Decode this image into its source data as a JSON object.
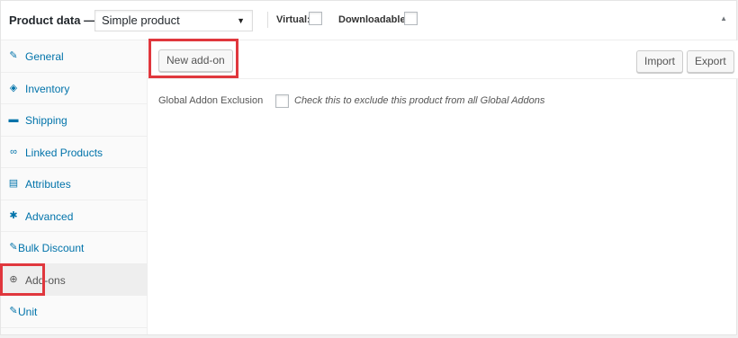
{
  "header": {
    "title": "Product data —",
    "product_type": "Simple product",
    "virtual_label": "Virtual:",
    "downloadable_label": "Downloadable:"
  },
  "sidebar": {
    "items": [
      {
        "label": "General",
        "icon": "wrench-icon",
        "glyph": "✎"
      },
      {
        "label": "Inventory",
        "icon": "tag-icon",
        "glyph": "◈"
      },
      {
        "label": "Shipping",
        "icon": "truck-icon",
        "glyph": "▬"
      },
      {
        "label": "Linked Products",
        "icon": "link-icon",
        "glyph": "∞"
      },
      {
        "label": "Attributes",
        "icon": "list-icon",
        "glyph": "▤"
      },
      {
        "label": "Advanced",
        "icon": "gear-icon",
        "glyph": "✱"
      },
      {
        "label": "Bulk Discount",
        "icon": "wrench-icon",
        "glyph": "✎"
      },
      {
        "label": "Add-ons",
        "icon": "plus-circle-icon",
        "glyph": "⊕"
      },
      {
        "label": "Unit",
        "icon": "wrench-icon",
        "glyph": "✎"
      }
    ]
  },
  "toolbar": {
    "new_addon": "New add-on",
    "import": "Import",
    "export": "Export"
  },
  "global_exclusion": {
    "label": "Global Addon Exclusion",
    "description": "Check this to exclude this product from all Global Addons"
  },
  "colors": {
    "highlight": "#e0373d",
    "link": "#0073aa"
  }
}
